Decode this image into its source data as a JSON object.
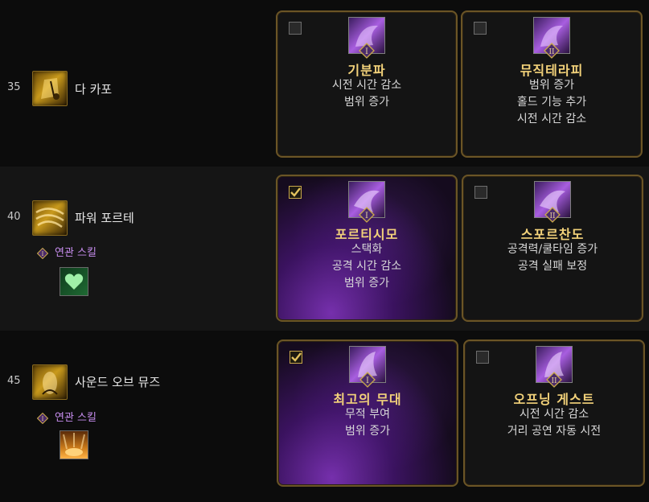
{
  "rows": [
    {
      "level": "35",
      "skill_name": "다 카포",
      "cards": [
        {
          "tier": "I",
          "title": "기분파",
          "desc": [
            "시전 시간 감소",
            "범위 증가"
          ],
          "selected": false
        },
        {
          "tier": "II",
          "title": "뮤직테라피",
          "desc": [
            "범위 증가",
            "홀드 기능 추가",
            "시전 시간 감소"
          ],
          "selected": false
        }
      ]
    },
    {
      "level": "40",
      "skill_name": "파워 포르테",
      "related_label": "연관 스킬",
      "cards": [
        {
          "tier": "I",
          "title": "포르티시모",
          "desc": [
            "스택화",
            "공격 시간 감소",
            "범위 증가"
          ],
          "selected": true
        },
        {
          "tier": "II",
          "title": "스포르찬도",
          "desc": [
            "공격력/쿨타임 증가",
            "공격 실패 보정"
          ],
          "selected": false
        }
      ]
    },
    {
      "level": "45",
      "skill_name": "사운드 오브 뮤즈",
      "related_label": "연관 스킬",
      "cards": [
        {
          "tier": "I",
          "title": "최고의 무대",
          "desc": [
            "무적 부여",
            "범위 증가"
          ],
          "selected": true
        },
        {
          "tier": "II",
          "title": "오프닝 게스트",
          "desc": [
            "시전 시간 감소",
            "거리 공연 자동 시전"
          ],
          "selected": false
        }
      ]
    }
  ],
  "colors": {
    "card_title": "#f3d27a",
    "related_text": "#c88ef0",
    "card_border": "#6b5526"
  }
}
